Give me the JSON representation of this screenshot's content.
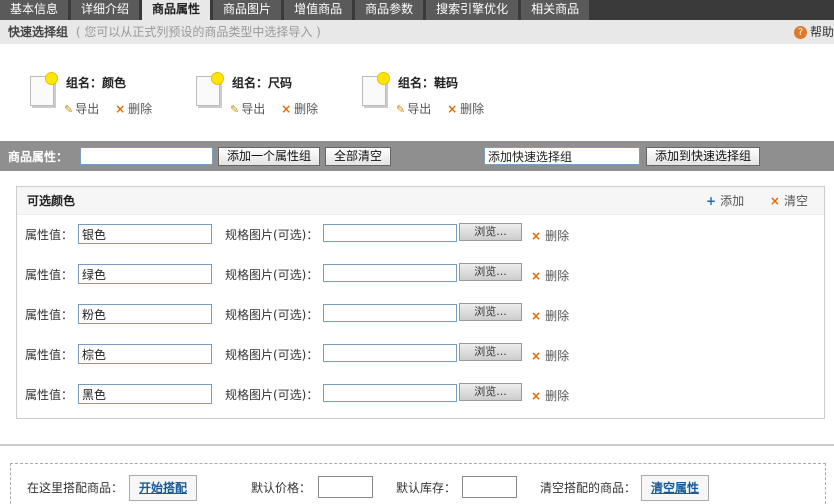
{
  "tabs": [
    {
      "label": "基本信息",
      "active": false
    },
    {
      "label": "详细介绍",
      "active": false
    },
    {
      "label": "商品属性",
      "active": true
    },
    {
      "label": "商品图片",
      "active": false
    },
    {
      "label": "增值商品",
      "active": false
    },
    {
      "label": "商品参数",
      "active": false
    },
    {
      "label": "搜索引擎优化",
      "active": false
    },
    {
      "label": "相关商品",
      "active": false
    }
  ],
  "quick": {
    "title": "快速选择组",
    "hint": "( 您可以从正式列预设的商品类型中选择导入 )",
    "help": "帮助",
    "help_glyph": "?"
  },
  "groups": [
    {
      "name": "组名：颜色",
      "export": "导出",
      "delete": "删除"
    },
    {
      "name": "组名：尺码",
      "export": "导出",
      "delete": "删除"
    },
    {
      "name": "组名：鞋码",
      "export": "导出",
      "delete": "删除"
    }
  ],
  "attr_bar": {
    "label": "商品属性：",
    "input_value": "",
    "add_group": "添加一个属性组",
    "clear_all": "全部清空",
    "quick_input_value": "添加快速选择组",
    "add_quick": "添加到快速选择组"
  },
  "panel": {
    "title": "可选颜色",
    "add": "添加",
    "clear": "清空"
  },
  "rows": [
    {
      "label": "属性值：",
      "value": "银色",
      "image_label": "规格图片(可选)：",
      "browse": "浏览...",
      "delete": "删除"
    },
    {
      "label": "属性值：",
      "value": "绿色",
      "image_label": "规格图片(可选)：",
      "browse": "浏览...",
      "delete": "删除"
    },
    {
      "label": "属性值：",
      "value": "粉色",
      "image_label": "规格图片(可选)：",
      "browse": "浏览...",
      "delete": "删除"
    },
    {
      "label": "属性值：",
      "value": "棕色",
      "image_label": "规格图片(可选)：",
      "browse": "浏览...",
      "delete": "删除"
    },
    {
      "label": "属性值：",
      "value": "黑色",
      "image_label": "规格图片(可选)：",
      "browse": "浏览...",
      "delete": "删除"
    }
  ],
  "match": {
    "label": "在这里搭配商品：",
    "start": "开始搭配",
    "price_label": "默认价格：",
    "stock_label": "默认库存：",
    "clear_label": "清空搭配的商品：",
    "clear_btn": "清空属性"
  },
  "colors": {
    "accent_icon": "#e46a00",
    "link": "#1a5a9a",
    "tab_bg": "#3a3a3a",
    "attr_bar": "#8f8f8f"
  },
  "icons": {
    "pencil": "pencil-icon",
    "delete": "x-icon",
    "add": "plus-icon",
    "help": "help-icon",
    "group": "document-icon"
  }
}
